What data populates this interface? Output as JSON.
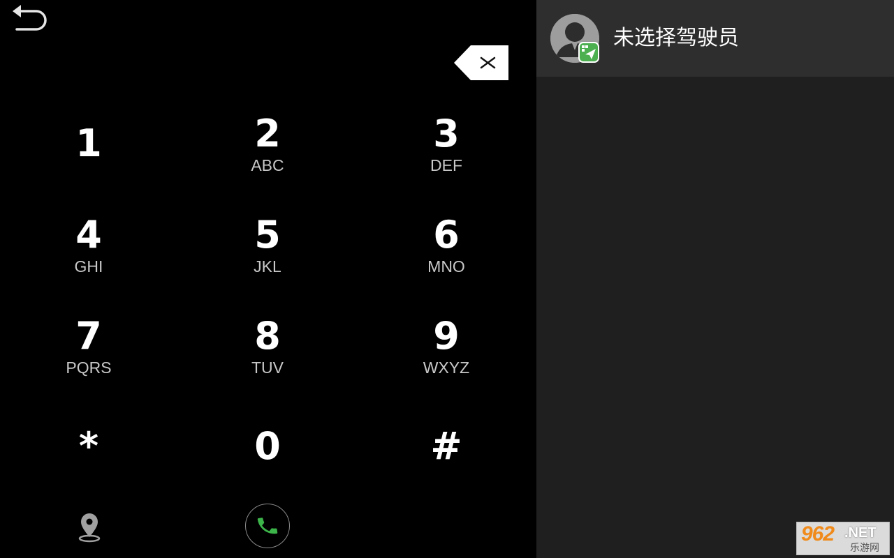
{
  "dialer": {
    "keys": [
      {
        "digit": "1",
        "letters": ""
      },
      {
        "digit": "2",
        "letters": "ABC"
      },
      {
        "digit": "3",
        "letters": "DEF"
      },
      {
        "digit": "4",
        "letters": "GHI"
      },
      {
        "digit": "5",
        "letters": "JKL"
      },
      {
        "digit": "6",
        "letters": "MNO"
      },
      {
        "digit": "7",
        "letters": "PQRS"
      },
      {
        "digit": "8",
        "letters": "TUV"
      },
      {
        "digit": "9",
        "letters": "WXYZ"
      },
      {
        "digit": "*",
        "letters": ""
      },
      {
        "digit": "0",
        "letters": ""
      },
      {
        "digit": "#",
        "letters": ""
      }
    ],
    "icons": {
      "back": "back-arrow-icon",
      "backspace": "backspace-icon",
      "location": "location-pin-icon",
      "call": "phone-call-icon"
    },
    "colors": {
      "call_green": "#3cb44a",
      "background": "#000000"
    }
  },
  "driver": {
    "name": "未选择驾驶员",
    "avatar_icon": "driver-avatar-icon",
    "badge_icon": "send-badge-icon",
    "badge_color": "#4caf50"
  },
  "watermark": {
    "number": "962",
    "suffix": ".NET",
    "cn": "乐游网"
  }
}
